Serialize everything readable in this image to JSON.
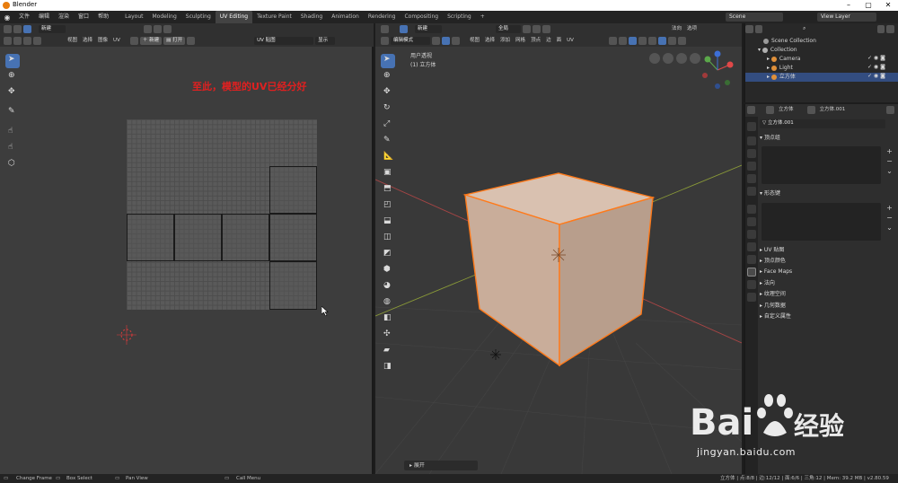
{
  "window": {
    "title": "Blender"
  },
  "topbar": {
    "menus": [
      "文件",
      "编辑",
      "渲染",
      "窗口",
      "帮助"
    ],
    "workspaces": [
      "Layout",
      "Modeling",
      "Sculpting",
      "UV Editing",
      "Texture Paint",
      "Shading",
      "Animation",
      "Rendering",
      "Compositing",
      "Scripting"
    ],
    "active_workspace": "UV Editing",
    "add_tab": "+",
    "scene_label": "Scene",
    "view_layer_label": "View Layer"
  },
  "uv_editor": {
    "header_row1": {
      "new_label": "新建"
    },
    "header_row2": {
      "menus": [
        "视图",
        "选择",
        "图像",
        "UV"
      ],
      "new_button": "新建",
      "open_button": "打开",
      "image_name": "UV 贴图",
      "display_label": "显示"
    },
    "annotation": "至此，模型的UV已经分好"
  },
  "viewport": {
    "header_row1": {
      "new_label": "新建",
      "global_label": "全局",
      "normal_label": "法向",
      "options_label": "选项"
    },
    "header_row2": {
      "mode": "编辑模式",
      "menus": [
        "视图",
        "选择",
        "添加",
        "网格",
        "顶点",
        "边",
        "面",
        "UV"
      ]
    },
    "view_label": "用户透视",
    "object_label": "(1) 立方体",
    "expand_panel_label": "展开",
    "gizmo_axes": {
      "x": "X",
      "y": "Y",
      "z": "Z"
    }
  },
  "outliner": {
    "items": [
      {
        "label": "Scene Collection"
      },
      {
        "label": "Collection"
      },
      {
        "label": "Camera"
      },
      {
        "label": "Light"
      },
      {
        "label": "立方体"
      }
    ]
  },
  "properties": {
    "object_name": "立方体",
    "mesh_name": "立方体.001",
    "data_name": "立方体.001",
    "sections_open": [
      "顶点组",
      "形态键"
    ],
    "sections_closed": [
      "UV 贴图",
      "顶点颜色",
      "Face Maps",
      "法向",
      "纹理空间",
      "几何数据",
      "自定义属性"
    ]
  },
  "statusbar": {
    "change_frame": "Change Frame",
    "box_select": "Box Select",
    "pan_view": "Pan View",
    "call_menu": "Call Menu",
    "stats": "立方体 | 点:8/8 | 边:12/12 | 面:6/6 | 三角:12 | Mem: 39.2 MB | v2.80.59"
  },
  "watermark": {
    "brand": "Bai",
    "brand_cn": "经验",
    "url": "jingyan.baidu.com"
  },
  "colors": {
    "accent_blue": "#4772b3",
    "selection_orange": "#ff7a1a",
    "annotation_red": "#e02020",
    "workspace_bg": "#393939"
  }
}
